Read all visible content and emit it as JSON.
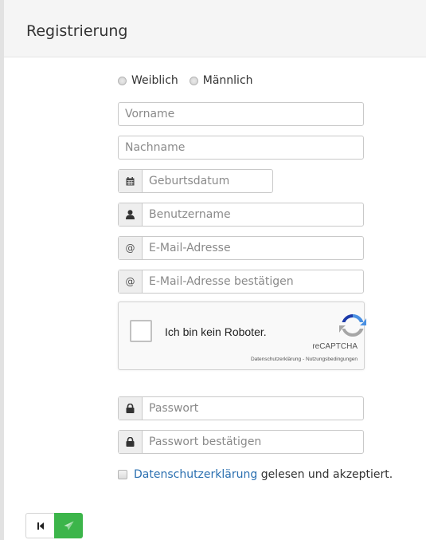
{
  "header": {
    "title": "Registrierung"
  },
  "gender": {
    "female_label": "Weiblich",
    "male_label": "Männlich"
  },
  "fields": {
    "firstname": {
      "placeholder": "Vorname",
      "value": ""
    },
    "lastname": {
      "placeholder": "Nachname",
      "value": ""
    },
    "birthdate": {
      "placeholder": "Geburtsdatum",
      "value": "",
      "icon": "calendar-icon"
    },
    "username": {
      "placeholder": "Benutzername",
      "value": "",
      "icon": "user-icon"
    },
    "email": {
      "placeholder": "E-Mail-Adresse",
      "value": "",
      "icon": "at-icon",
      "icon_text": "@"
    },
    "email_confirm": {
      "placeholder": "E-Mail-Adresse bestätigen",
      "value": "",
      "icon": "at-icon",
      "icon_text": "@"
    },
    "password": {
      "placeholder": "Passwort",
      "value": "",
      "icon": "lock-icon"
    },
    "password_confirm": {
      "placeholder": "Passwort bestätigen",
      "value": "",
      "icon": "lock-icon"
    }
  },
  "captcha": {
    "label": "Ich bin kein Roboter.",
    "brand": "reCAPTCHA",
    "links": "Datenschutzerklärung - Nutzungsbedingungen"
  },
  "consent": {
    "link_text": "Datenschutzerklärung",
    "text": " gelesen und akzeptiert."
  },
  "buttons": {
    "back_icon": "skip-back-icon",
    "send_icon": "send-icon"
  },
  "colors": {
    "accent_green": "#3cb54a",
    "link_blue": "#2a6fb0",
    "header_bg": "#f5f5f5"
  }
}
